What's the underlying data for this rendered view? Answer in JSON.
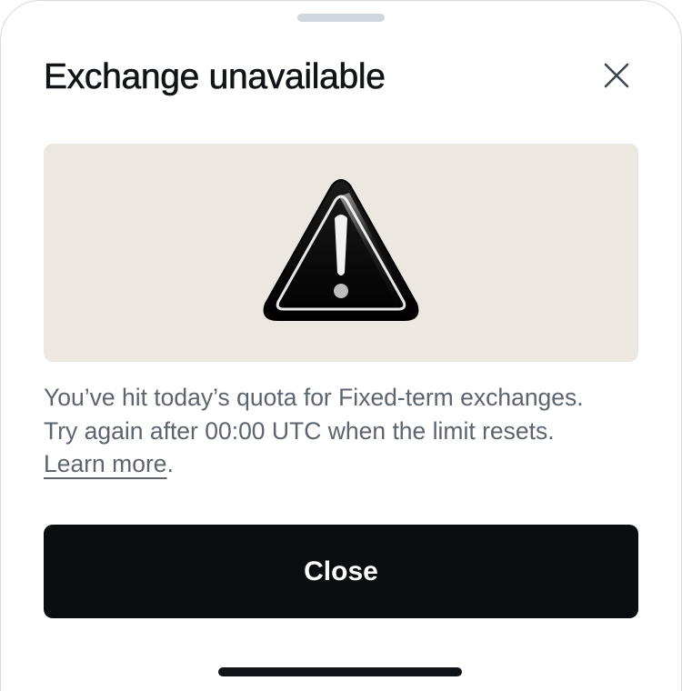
{
  "sheet": {
    "title": "Exchange unavailable",
    "close_icon": "close-icon"
  },
  "illustration": {
    "icon": "warning-icon",
    "background_color": "#ece8e1"
  },
  "message": {
    "line1": "You’ve hit today’s quota for Fixed-term exchanges.",
    "line2": "Try again after 00:00 UTC when the limit resets.",
    "learn_more_label": "Learn more",
    "learn_more_suffix": "."
  },
  "actions": {
    "close_label": "Close",
    "close_button_color": "#0b0d10"
  },
  "colors": {
    "title": "#111418",
    "body_text": "#5c6470",
    "grabber": "#cfd7df"
  }
}
